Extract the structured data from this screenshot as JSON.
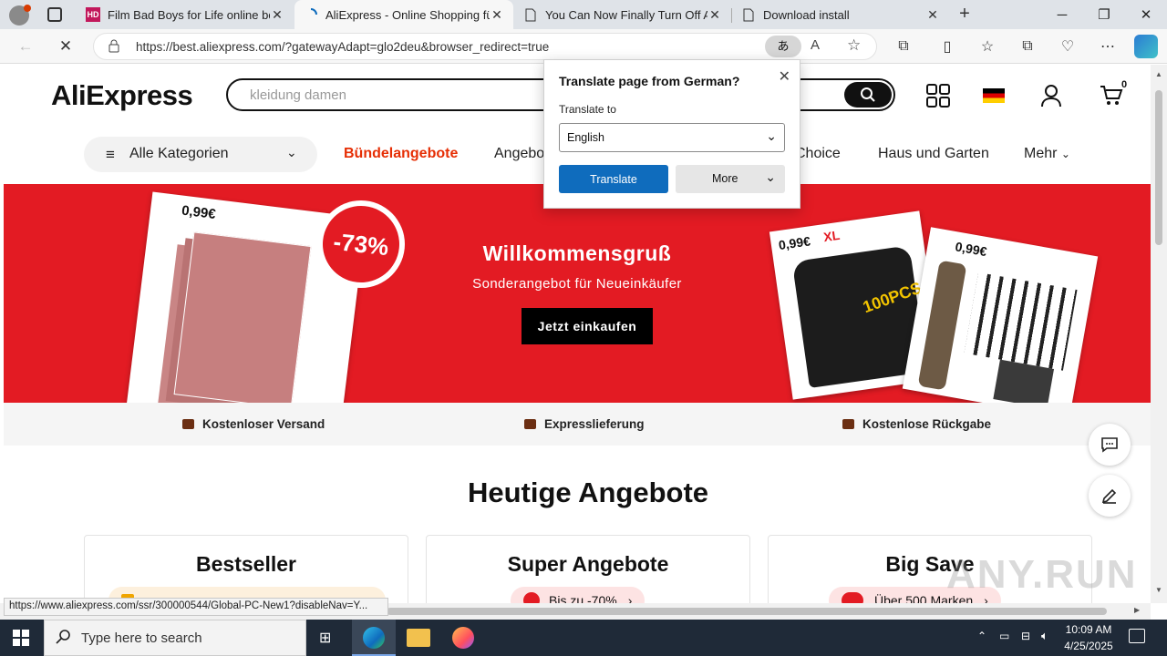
{
  "browser": {
    "tabs": [
      {
        "title": "Film Bad Boys for Life online besp",
        "favicon": "HD"
      },
      {
        "title": "AliExpress - Online Shopping für",
        "favicon": "loading"
      },
      {
        "title": "You Can Now Finally Turn Off All",
        "favicon": "page"
      },
      {
        "title": "Download install",
        "favicon": "page"
      }
    ],
    "url": "https://best.aliexpress.com/?gatewayAdapt=glo2deu&browser_redirect=true",
    "status_url": "https://www.aliexpress.com/ssr/300000544/Global-PC-New1?disableNav=Y..."
  },
  "translate_popup": {
    "title": "Translate page from German?",
    "label": "Translate to",
    "selected_language": "English",
    "translate_label": "Translate",
    "more_label": "More"
  },
  "header": {
    "logo_text": "AliExpress",
    "search_placeholder": "kleidung damen",
    "cart_count": "0"
  },
  "nav": {
    "categories_label": "Alle Kategorien",
    "links": [
      "Bündelangebote",
      "Angebo",
      "Choice",
      "Haus und Garten",
      "Mehr"
    ]
  },
  "banner": {
    "title": "Willkommensgruß",
    "subtitle": "Sonderangebot für Neueinkäufer",
    "button": "Jetzt einkaufen",
    "discount": "-73%",
    "price_left": "0,99€",
    "price_mid": "0,99€",
    "xl": "XL",
    "pcs": "100PCS",
    "price_right": "0,99€"
  },
  "features": [
    "Kostenloser Versand",
    "Expresslieferung",
    "Kostenlose Rückgabe"
  ],
  "deals": {
    "heading": "Heutige Angebote",
    "cards": [
      {
        "title": "Bestseller",
        "pill": ""
      },
      {
        "title": "Super Angebote",
        "pill": "Bis zu -70%"
      },
      {
        "title": "Big Save",
        "pill": "Über 500 Marken"
      }
    ]
  },
  "taskbar": {
    "search_placeholder": "Type here to search",
    "time": "10:09 AM",
    "date": "4/25/2025"
  },
  "watermark": "ANY.RUN",
  "colors": {
    "brand_red": "#e31b23",
    "accent_red": "#e62e04",
    "edge_blue": "#0f6cbd"
  }
}
